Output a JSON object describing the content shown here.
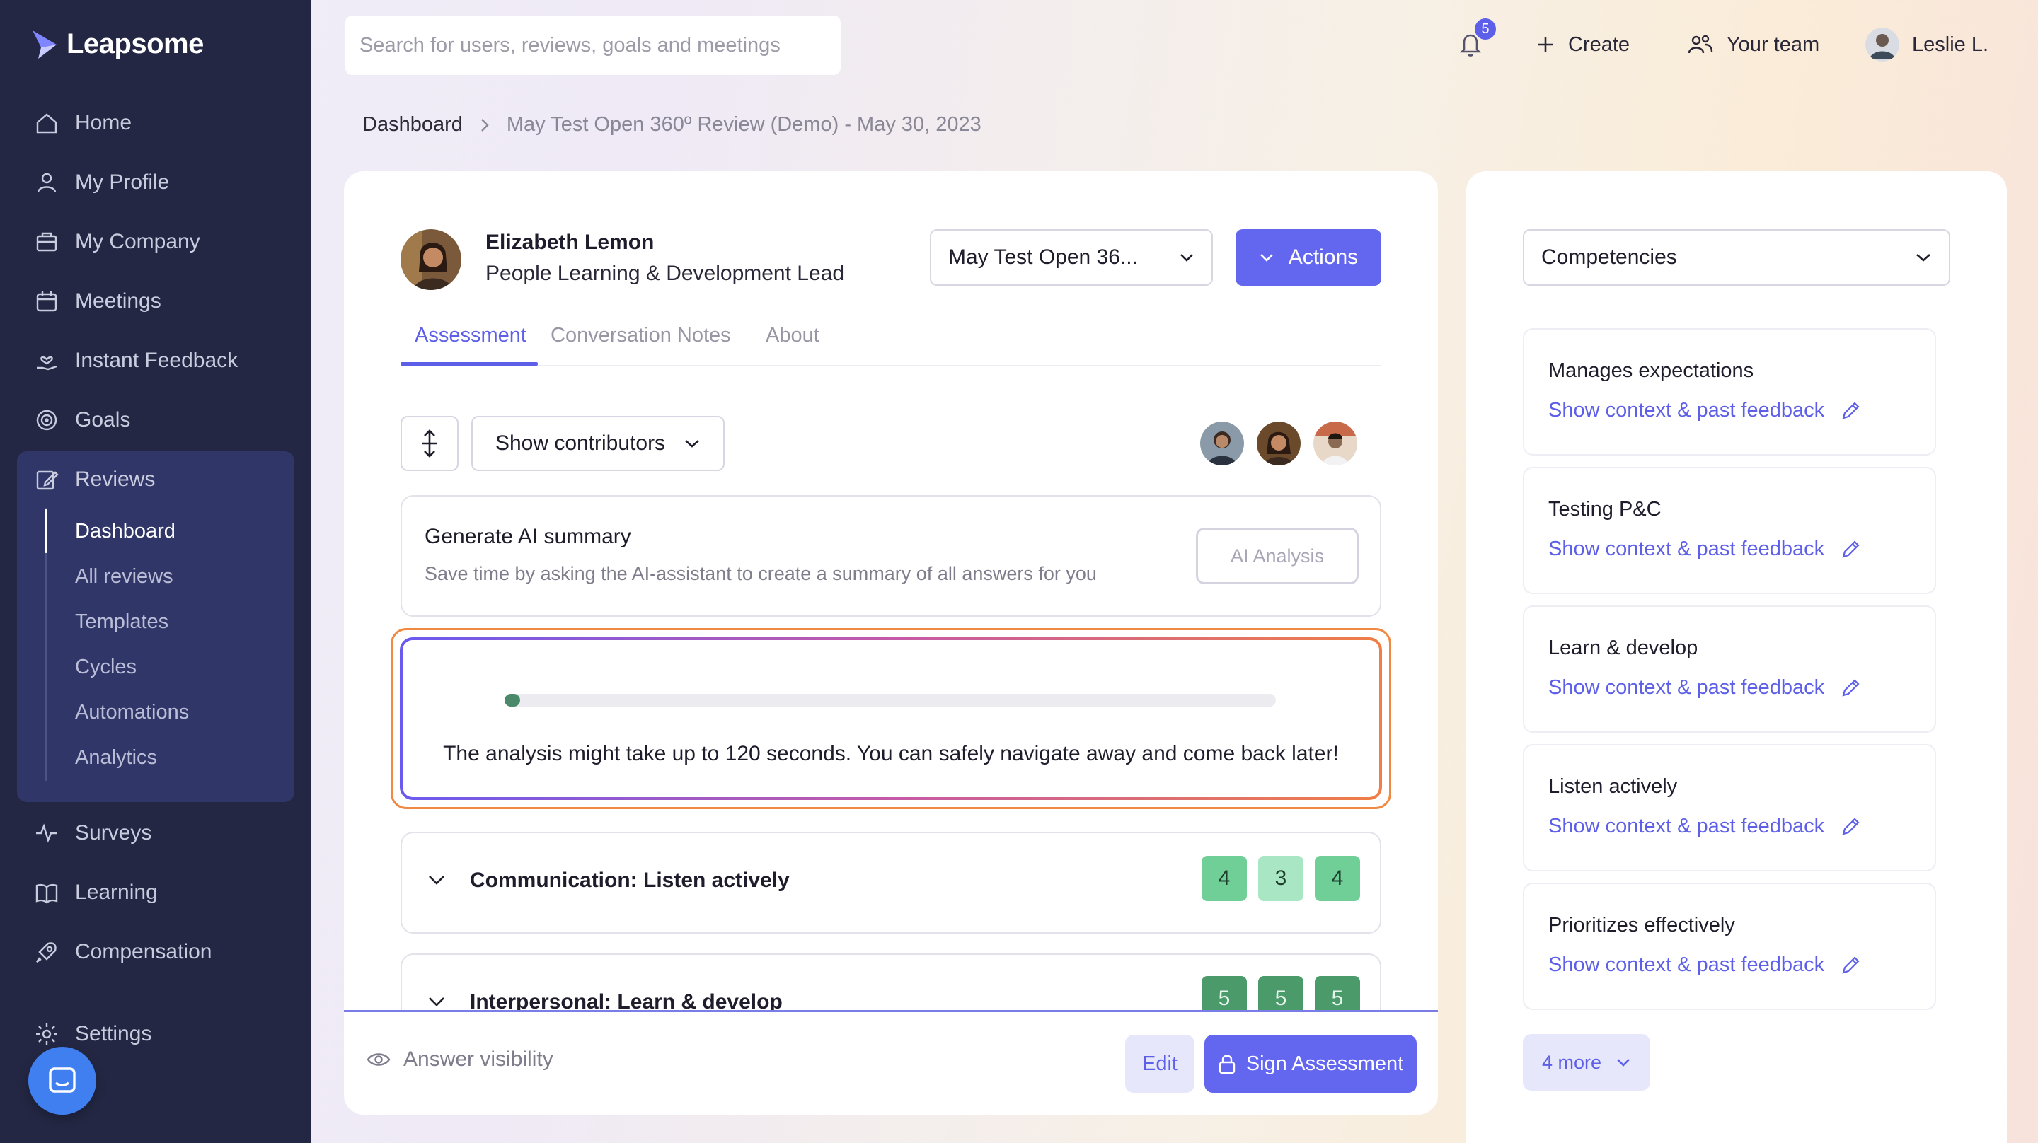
{
  "app": {
    "name": "Leapsome"
  },
  "sidebar": {
    "items": [
      {
        "label": "Home",
        "icon": "home-icon"
      },
      {
        "label": "My Profile",
        "icon": "user-icon"
      },
      {
        "label": "My Company",
        "icon": "building-icon"
      },
      {
        "label": "Meetings",
        "icon": "calendar-icon"
      },
      {
        "label": "Instant Feedback",
        "icon": "hand-heart-icon"
      },
      {
        "label": "Goals",
        "icon": "target-icon"
      },
      {
        "label": "Reviews",
        "icon": "edit-icon"
      },
      {
        "label": "Surveys",
        "icon": "pulse-icon"
      },
      {
        "label": "Learning",
        "icon": "book-icon"
      },
      {
        "label": "Compensation",
        "icon": "rocket-icon"
      },
      {
        "label": "Settings",
        "icon": "gear-icon"
      }
    ],
    "reviews_sub": [
      "Dashboard",
      "All reviews",
      "Templates",
      "Cycles",
      "Automations",
      "Analytics"
    ],
    "active_sub": "Dashboard"
  },
  "topbar": {
    "search_placeholder": "Search for users, reviews, goals and meetings",
    "notifications": "5",
    "create": "Create",
    "team": "Your team",
    "user": "Leslie L."
  },
  "breadcrumb": {
    "home": "Dashboard",
    "current": "May Test Open 360º Review (Demo) - May 30, 2023"
  },
  "review": {
    "person_name": "Elizabeth Lemon",
    "person_role": "People Learning & Development Lead",
    "cycle_select": "May Test Open 36...",
    "actions": "Actions",
    "tabs": [
      "Assessment",
      "Conversation Notes",
      "About"
    ],
    "show_contributors": "Show contributors",
    "ai": {
      "title": "Generate AI summary",
      "subtitle": "Save time by asking the AI-assistant to create a summary of all answers for you",
      "button": "AI Analysis"
    },
    "analysis": {
      "progress": 0.02,
      "message": "The analysis might take up to 120 seconds. You can safely navigate away and come back later!"
    },
    "competencies": [
      {
        "title": "Communication: Listen actively",
        "scores": [
          "4",
          "3",
          "4"
        ]
      },
      {
        "title": "Interpersonal: Learn & develop",
        "scores": [
          "5",
          "5",
          "5"
        ]
      }
    ],
    "footer": {
      "visibility": "Answer visibility",
      "edit": "Edit",
      "sign": "Sign Assessment"
    }
  },
  "right_panel": {
    "select": "Competencies",
    "link_label": "Show context & past feedback",
    "cards": [
      "Manages expectations",
      "Testing P&C",
      "Learn & develop",
      "Listen actively",
      "Prioritizes effectively"
    ],
    "more": "4 more"
  },
  "colors": {
    "sidebar_bg": "#232743",
    "accent": "#6366ef",
    "score_4": "#6fcf97",
    "score_3": "#a8e6c4",
    "score_5": "#4a9a6a",
    "analysis_border": "#f08a42"
  }
}
